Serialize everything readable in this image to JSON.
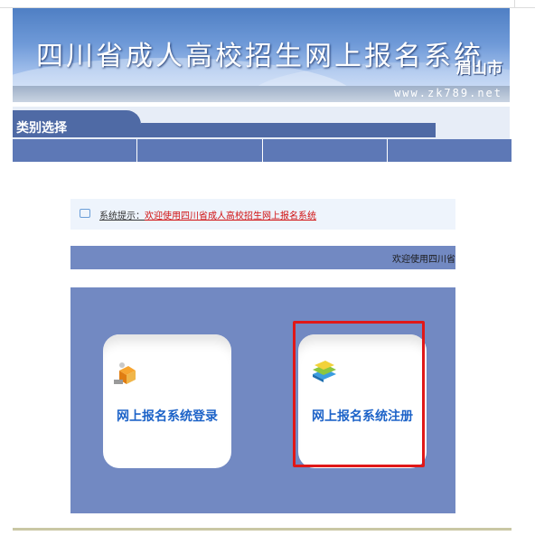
{
  "header": {
    "title": "四川省成人高校招生网上报名系统",
    "city": "眉山市",
    "url": "www.zk789.net"
  },
  "category": {
    "title": "类别选择",
    "nav_items": [
      "",
      "",
      "",
      ""
    ]
  },
  "notice": {
    "label": "系统提示：",
    "message": "欢迎使用四川省成人高校招生网上报名系统"
  },
  "welcome": {
    "text": "欢迎使用四川省"
  },
  "actions": {
    "login_label": "网上报名系统登录",
    "register_label": "网上报名系统注册"
  },
  "colors": {
    "nav": "#5d78b6",
    "panel": "#7289c2",
    "highlight": "#e01818",
    "link": "#1d63c8"
  }
}
